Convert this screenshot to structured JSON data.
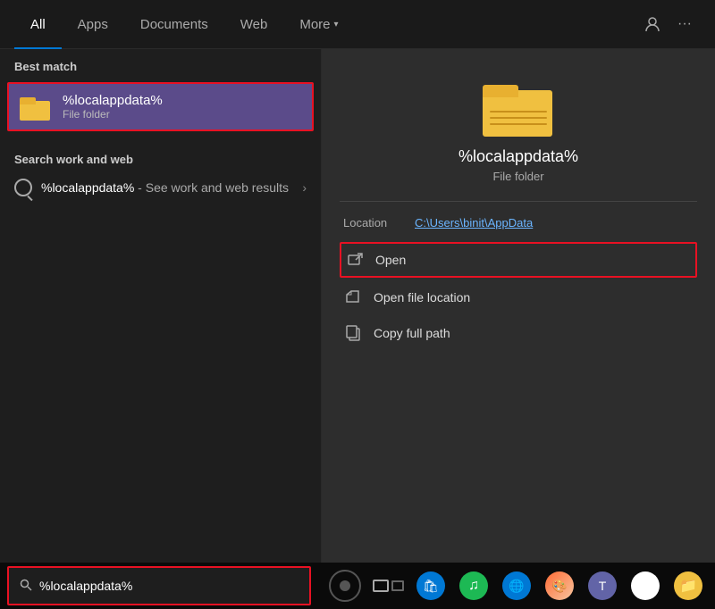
{
  "nav": {
    "tabs": [
      {
        "id": "all",
        "label": "All",
        "active": true
      },
      {
        "id": "apps",
        "label": "Apps"
      },
      {
        "id": "documents",
        "label": "Documents"
      },
      {
        "id": "web",
        "label": "Web"
      },
      {
        "id": "more",
        "label": "More",
        "hasArrow": true
      }
    ],
    "account_icon": "👤",
    "more_icon": "···"
  },
  "left": {
    "best_match_label": "Best match",
    "best_match_name": "%localappdata%",
    "best_match_type": "File folder",
    "search_web_label": "Search work and web",
    "search_web_query": "%localappdata%",
    "search_web_suffix": " - See work and web results"
  },
  "right": {
    "folder_name": "%localappdata%",
    "folder_type": "File folder",
    "location_label": "Location",
    "location_value": "C:\\Users\\binit\\AppData",
    "actions": [
      {
        "id": "open",
        "label": "Open",
        "highlighted": true
      },
      {
        "id": "open-file-location",
        "label": "Open file location",
        "highlighted": false
      },
      {
        "id": "copy-full-path",
        "label": "Copy full path",
        "highlighted": false
      }
    ]
  },
  "taskbar": {
    "search_placeholder": "%localappdata%",
    "search_value": "%localappdata%"
  }
}
